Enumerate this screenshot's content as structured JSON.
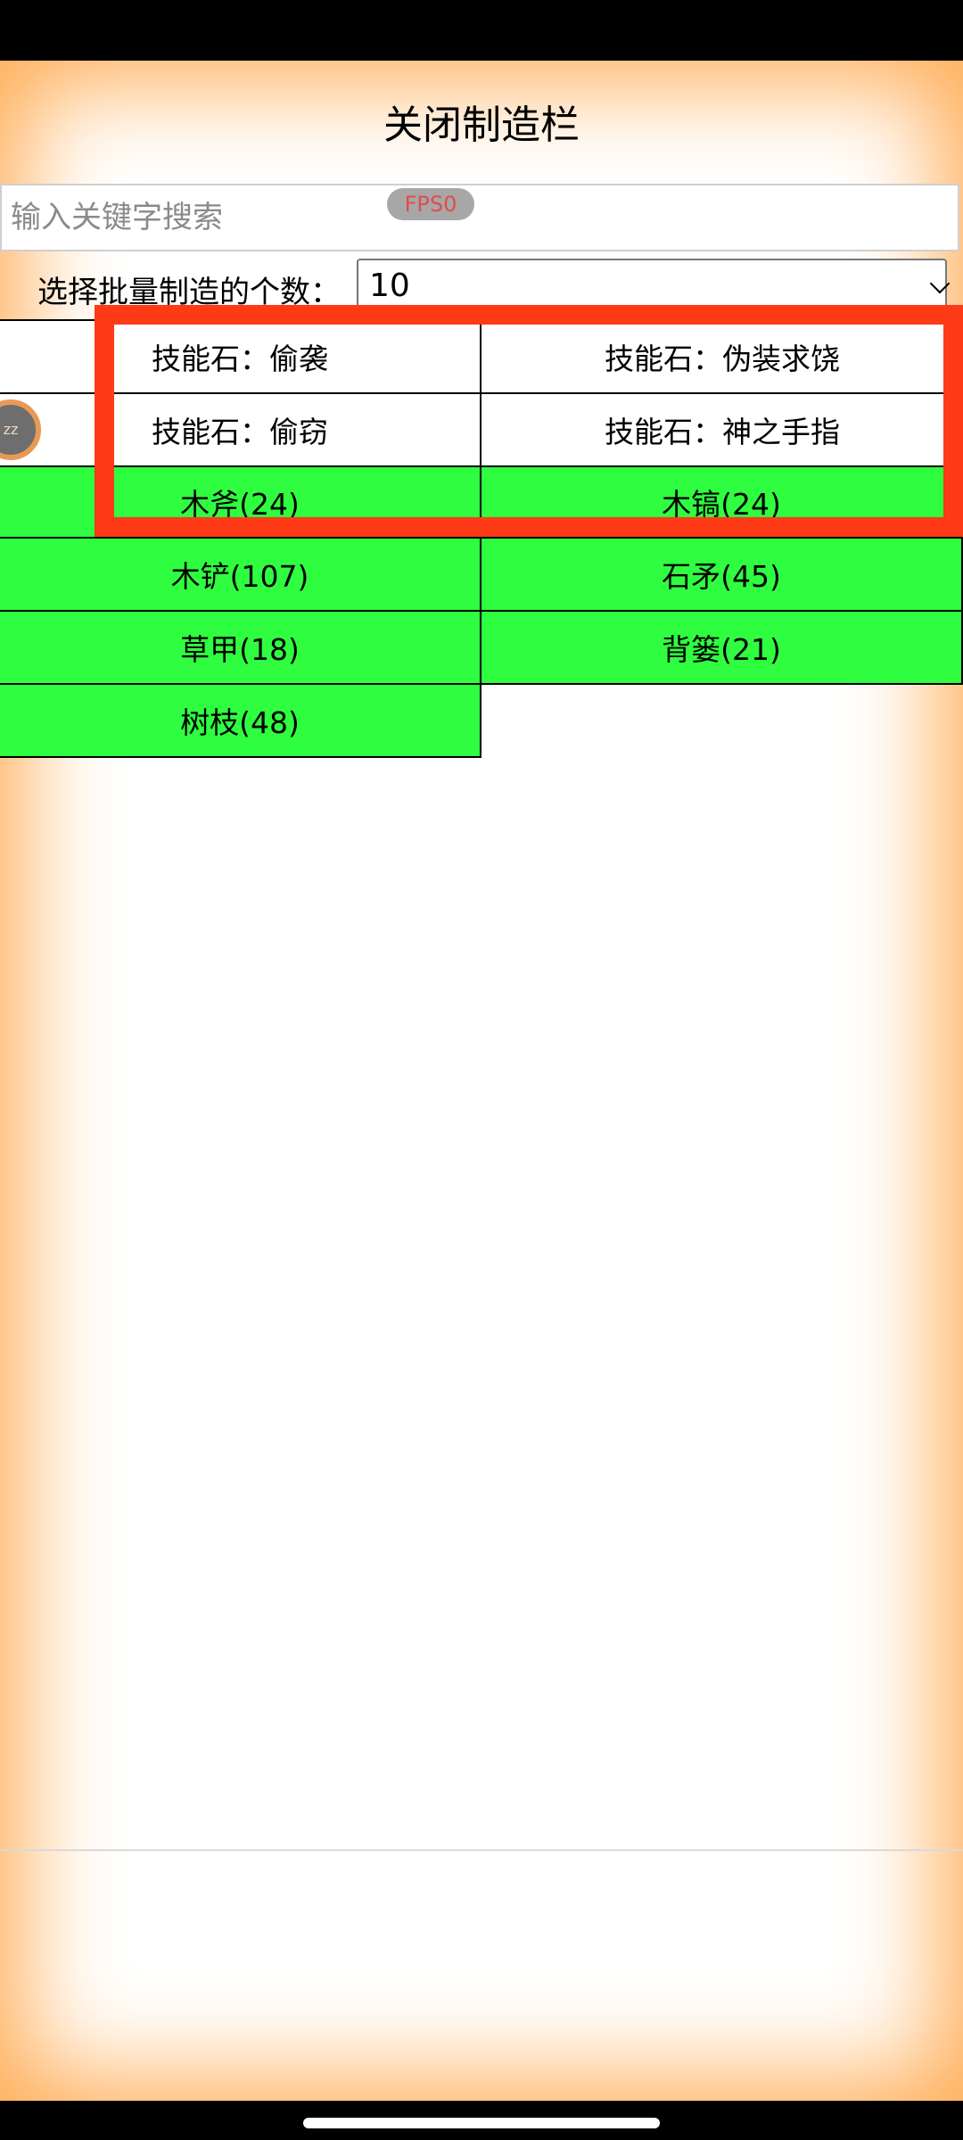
{
  "header": {
    "title": "关闭制造栏"
  },
  "search": {
    "placeholder": "输入关键字搜索",
    "value": ""
  },
  "fps_badge": "FPS0",
  "quantity": {
    "label": "选择批量制造的个数：",
    "selected": "10"
  },
  "skill_stones": [
    "技能石：偷袭",
    "技能石：伪装求饶",
    "技能石：偷窃",
    "技能石：神之手指"
  ],
  "recipes": [
    "木斧(24)",
    "木镐(24)",
    "木铲(107)",
    "石矛(45)",
    "草甲(18)",
    "背篓(21)",
    "树枝(48)"
  ],
  "sleep_icon_text": "zz",
  "colors": {
    "recipe_bg": "#2efe3f",
    "highlight": "#ff3a17",
    "edge_glow": "#ffab52",
    "fps_text": "#e14d4d"
  }
}
